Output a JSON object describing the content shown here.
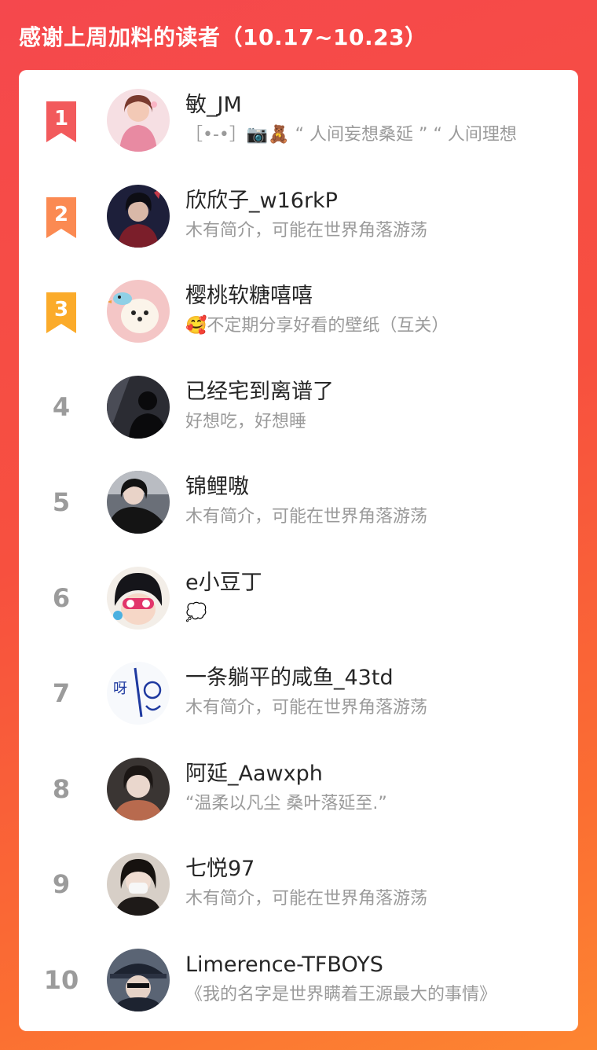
{
  "header": {
    "title": "感谢上周加料的读者（10.17~10.23）"
  },
  "colors": {
    "rank1": "#f25a5c",
    "rank2": "#fb8a52",
    "rank3": "#fbab2a",
    "rank_gray": "#9b9b9b"
  },
  "readers": [
    {
      "rank": "1",
      "name": "敏_JM",
      "bio": "［•-•］📷🧸 “ 人间妄想桑延 ” “ 人间理想",
      "avatar_icon": "girl-avatar-pink"
    },
    {
      "rank": "2",
      "name": "欣欣子_w16rkP",
      "bio": "木有简介，可能在世界角落游荡",
      "avatar_icon": "anime-boy-avatar"
    },
    {
      "rank": "3",
      "name": "樱桃软糖嘻嘻",
      "bio": "🥰不定期分享好看的壁纸（互关）",
      "avatar_icon": "puppy-avatar"
    },
    {
      "rank": "4",
      "name": "已经宅到离谱了",
      "bio": "好想吃，好想睡",
      "avatar_icon": "silhouette-avatar"
    },
    {
      "rank": "5",
      "name": "锦鲤嗷",
      "bio": "木有简介，可能在世界角落游荡",
      "avatar_icon": "dark-portrait-avatar"
    },
    {
      "rank": "6",
      "name": "e小豆丁",
      "bio": "💭",
      "avatar_icon": "cartoon-girl-avatar"
    },
    {
      "rank": "7",
      "name": "一条躺平的咸鱼_43td",
      "bio": "木有简介，可能在世界角落游荡",
      "avatar_icon": "doodle-avatar"
    },
    {
      "rank": "8",
      "name": "阿延_Aawxph",
      "bio": "“温柔以凡尘 桑叶落延至.”",
      "avatar_icon": "girl-portrait-avatar"
    },
    {
      "rank": "9",
      "name": "七悦97",
      "bio": "木有简介，可能在世界角落游荡",
      "avatar_icon": "masked-girl-avatar"
    },
    {
      "rank": "10",
      "name": "Limerence-TFBOYS",
      "bio": "《我的名字是世界瞒着王源最大的事情》",
      "avatar_icon": "anime-hat-avatar"
    }
  ]
}
